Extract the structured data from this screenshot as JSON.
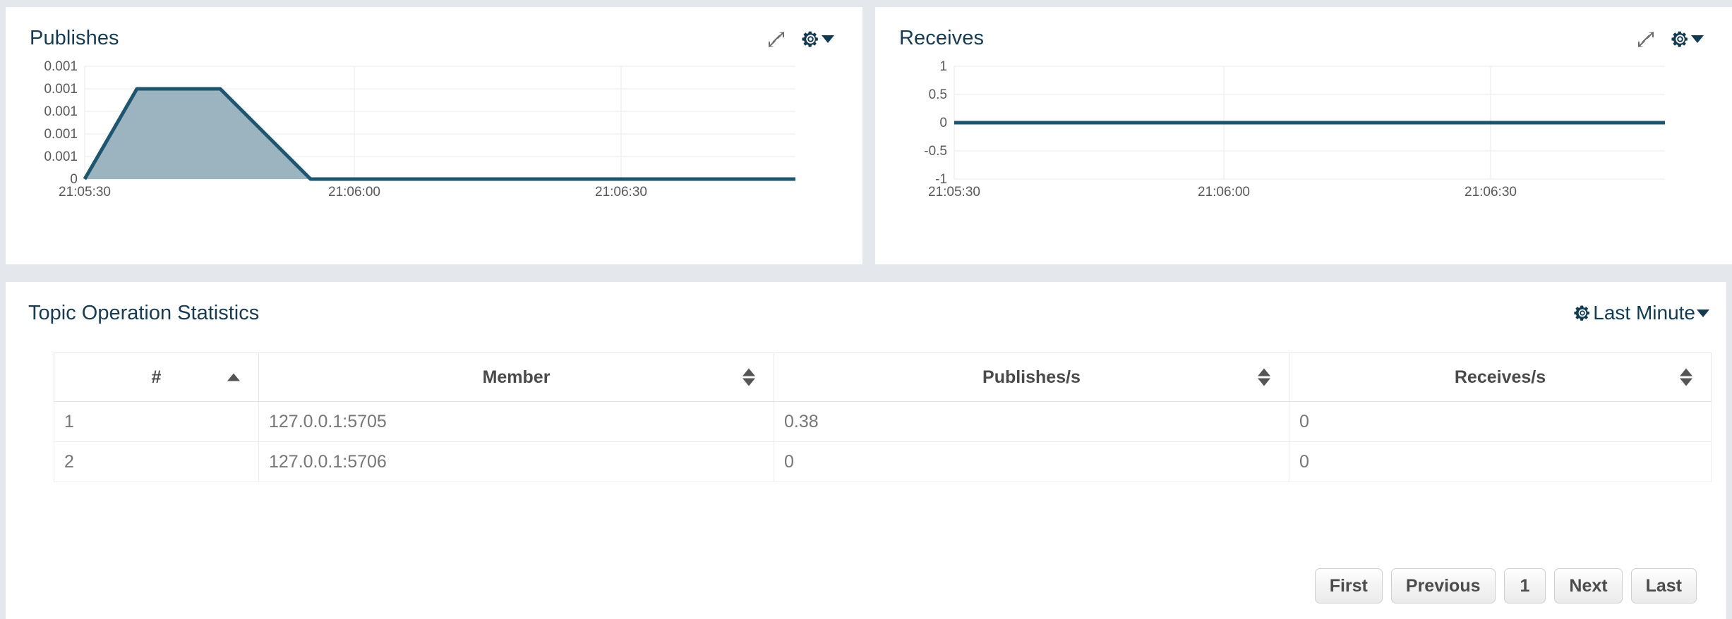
{
  "theme": {
    "page_background": "#e4e7eb",
    "panel_background": "#ffffff",
    "title_color": "#153c54",
    "chart_line_color": "#1d5670",
    "chart_fill_color": "#9bb4bf",
    "grid_color": "#f0f0f0",
    "axis_text_color": "#595959",
    "table_text_color": "#777777"
  },
  "panels": {
    "publishes": {
      "title": "Publishes",
      "expand_icon": "expand-arrows-icon",
      "gear_icon": "gear-icon",
      "caret_icon": "chevron-down-icon"
    },
    "receives": {
      "title": "Receives",
      "expand_icon": "expand-arrows-icon",
      "gear_icon": "gear-icon",
      "caret_icon": "chevron-down-icon"
    }
  },
  "chart_data": [
    {
      "id": "publishes",
      "type": "area",
      "title": "Publishes",
      "xlabel": "",
      "ylabel": "",
      "grid": true,
      "legend": null,
      "x_ticks": [
        "21:05:30",
        "21:06:00",
        "21:06:30"
      ],
      "y_ticks": [
        "0.001",
        "0.001",
        "0.001",
        "0.001",
        "0.001",
        "0"
      ],
      "ylim": [
        0,
        0.0012
      ],
      "xlim": [
        "21:05:30",
        "21:06:50"
      ],
      "x": [
        "21:05:30",
        "21:05:36",
        "21:05:42",
        "21:05:56",
        "21:06:50"
      ],
      "values": [
        0,
        0.001,
        0.001,
        0,
        0
      ]
    },
    {
      "id": "receives",
      "type": "line",
      "title": "Receives",
      "xlabel": "",
      "ylabel": "",
      "grid": true,
      "legend": null,
      "x_ticks": [
        "21:05:30",
        "21:06:00",
        "21:06:30"
      ],
      "y_ticks": [
        "1",
        "0.5",
        "0",
        "-0.5",
        "-1"
      ],
      "ylim": [
        -1,
        1
      ],
      "xlim": [
        "21:05:30",
        "21:06:50"
      ],
      "x": [
        "21:05:30",
        "21:06:50"
      ],
      "values": [
        0,
        0
      ]
    }
  ],
  "stats": {
    "title": "Topic Operation Statistics",
    "range_label": "Last Minute",
    "range_gear_icon": "gear-icon",
    "range_caret_icon": "chevron-down-icon",
    "columns": [
      {
        "label": "#",
        "sort": "asc"
      },
      {
        "label": "Member",
        "sort": "none"
      },
      {
        "label": "Publishes/s",
        "sort": "none"
      },
      {
        "label": "Receives/s",
        "sort": "none"
      }
    ],
    "rows": [
      {
        "num": "1",
        "member": "127.0.0.1:5705",
        "publishes": "0.38",
        "receives": "0"
      },
      {
        "num": "2",
        "member": "127.0.0.1:5706",
        "publishes": "0",
        "receives": "0"
      }
    ],
    "pagination": {
      "first": "First",
      "previous": "Previous",
      "current_page": "1",
      "next": "Next",
      "last": "Last"
    }
  }
}
